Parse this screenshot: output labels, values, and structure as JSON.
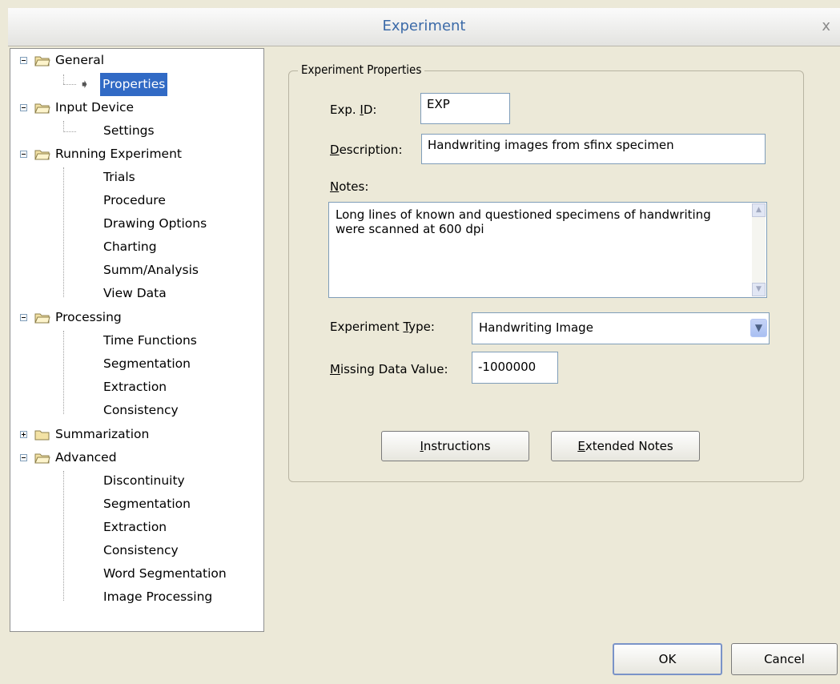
{
  "window": {
    "title": "Experiment",
    "close_glyph": "x"
  },
  "tree": {
    "general": {
      "label": "General",
      "children": [
        "Properties"
      ]
    },
    "input_device": {
      "label": "Input Device",
      "children": [
        "Settings"
      ]
    },
    "running": {
      "label": "Running Experiment",
      "children": [
        "Trials",
        "Procedure",
        "Drawing Options",
        "Charting",
        "Summ/Analysis",
        "View Data"
      ]
    },
    "processing": {
      "label": "Processing",
      "children": [
        "Time Functions",
        "Segmentation",
        "Extraction",
        "Consistency"
      ]
    },
    "summarization": {
      "label": "Summarization"
    },
    "advanced": {
      "label": "Advanced",
      "children": [
        "Discontinuity",
        "Segmentation",
        "Extraction",
        "Consistency",
        "Word Segmentation",
        "Image Processing"
      ]
    }
  },
  "props": {
    "legend": "Experiment Properties",
    "exp_id": {
      "label_pre": "Exp. ",
      "label_u": "I",
      "label_post": "D:",
      "value": "EXP"
    },
    "description": {
      "label_u": "D",
      "label_post": "escription:",
      "value": "Handwriting images from sfinx specimen"
    },
    "notes": {
      "label_u": "N",
      "label_post": "otes:",
      "value": "Long lines of known and questioned specimens of handwriting were scanned at 600 dpi"
    },
    "exp_type": {
      "label_pre": "Experiment ",
      "label_u": "T",
      "label_post": "ype:",
      "value": "Handwriting Image"
    },
    "missing": {
      "label_u": "M",
      "label_post": "issing Data Value:",
      "value": "-1000000"
    },
    "instructions_btn": {
      "label_u": "I",
      "label_post": "nstructions"
    },
    "extended_btn": {
      "label_u": "E",
      "label_post": "xtended Notes"
    }
  },
  "footer": {
    "ok": "OK",
    "cancel": "Cancel"
  },
  "colors": {
    "selection": "#316ac5",
    "title": "#3b6aa8",
    "dialog_bg": "#ece9d8"
  },
  "icons": {
    "folder": "folder-icon",
    "arrow": "arrow-right-icon",
    "expander": "tree-expander-icon"
  }
}
